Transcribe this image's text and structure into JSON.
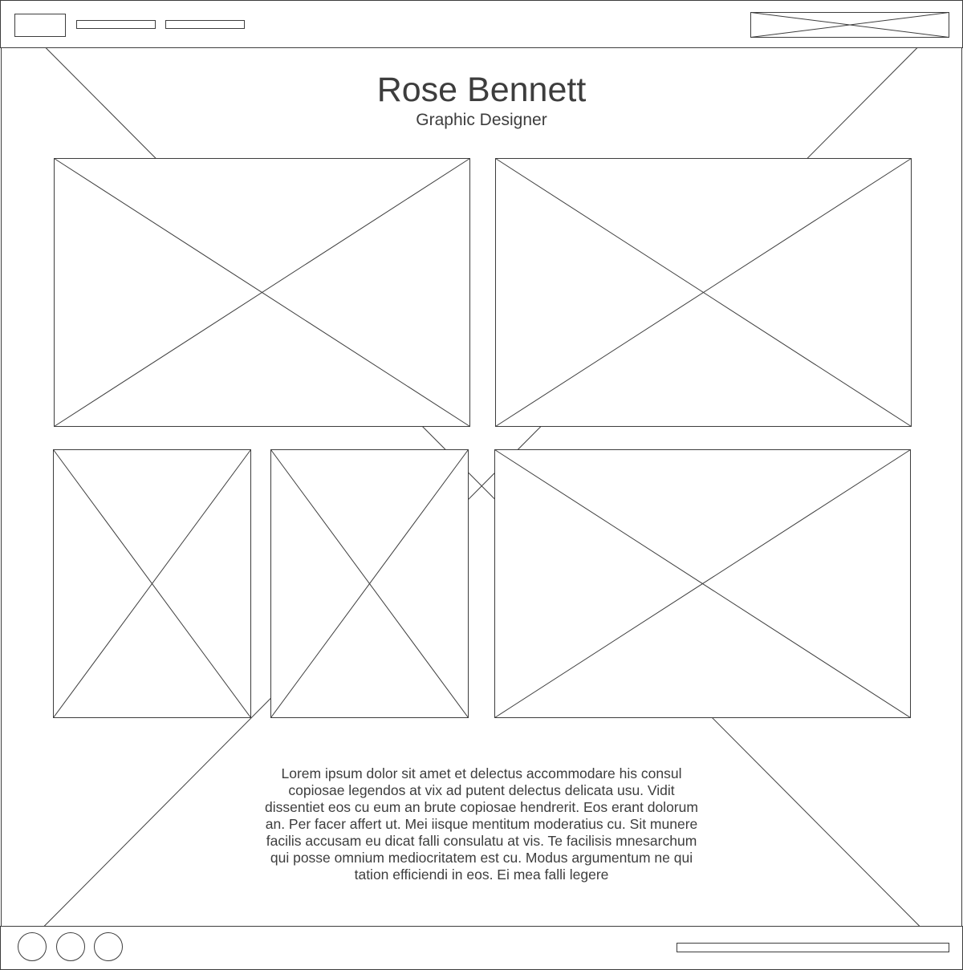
{
  "header": {
    "name": "Rose Bennett",
    "role": "Graphic Designer"
  },
  "about": {
    "text": "Lorem ipsum dolor sit amet et delectus accommodare his consul copiosae legendos at vix ad putent delectus delicata usu. Vidit dissentiet eos cu eum an brute copiosae hendrerit. Eos erant dolorum an. Per facer affert ut. Mei iisque mentitum moderatius cu. Sit munere facilis accusam eu dicat falli consulatu at vis. Te facilisis mnesarchum qui posse omnium mediocritatem est cu. Modus argumentum ne qui tation efficiendi in eos. Ei mea falli legere"
  },
  "footer": {
    "social_icons": [
      "social-icon-1",
      "social-icon-2",
      "social-icon-3"
    ]
  }
}
